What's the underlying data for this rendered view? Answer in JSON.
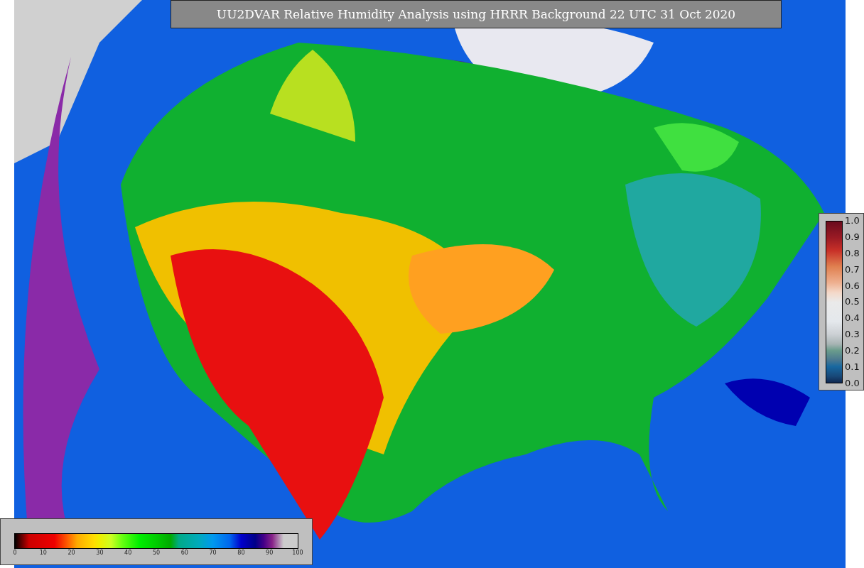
{
  "title": "UU2DVAR Relative Humidity Analysis using HRRR Background 22 UTC 31 Oct 2020",
  "humidity_scale": {
    "ticks": [
      "0",
      "10",
      "20",
      "30",
      "40",
      "50",
      "60",
      "70",
      "80",
      "90",
      "100"
    ]
  },
  "station_scale": {
    "ticks": [
      "1.0",
      "0.9",
      "0.8",
      "0.7",
      "0.6",
      "0.5",
      "0.4",
      "0.3",
      "0.2",
      "0.1",
      "0.0"
    ]
  }
}
